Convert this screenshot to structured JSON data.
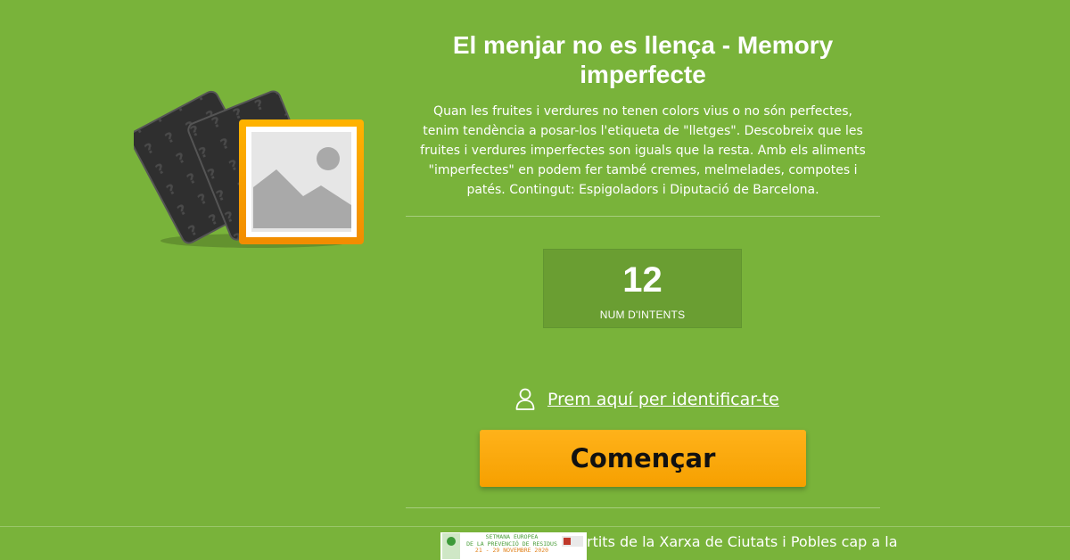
{
  "game": {
    "title": "El menjar no es llença - Memory imperfecte",
    "description": "Quan les fruites i verdures no tenen colors vius o no són perfectes, tenim tendència a posar-los l'etiqueta de \"lletges\". Descobreix que les fruites i verdures imperfectes son iguals que la resta. Amb els aliments \"imperfectes\" en podem fer també cremes, melmelades, compotes i patés. Contingut: Espigoladors i Diputació de Barcelona.",
    "icon": "memory-cards-icon"
  },
  "stats": {
    "attempts_value": "12",
    "attempts_label": "NUM D'INTENTS"
  },
  "login": {
    "icon": "user-icon",
    "link_text": "Prem aquí per identificar-te"
  },
  "start_button": {
    "label": "Començar"
  },
  "footer": {
    "banner_lines": [
      "SETMANA EUROPEA",
      "DE LA PREVENCIÓ DE RESIDUS",
      "21 - 29 NOVEMBRE 2020"
    ],
    "partial_text": "rtits de la Xarxa de Ciutats i Pobles cap a la"
  },
  "colors": {
    "background": "#79b33a",
    "stat_box": "#6a9e32",
    "button": "#f6a000",
    "text": "#ffffff"
  }
}
